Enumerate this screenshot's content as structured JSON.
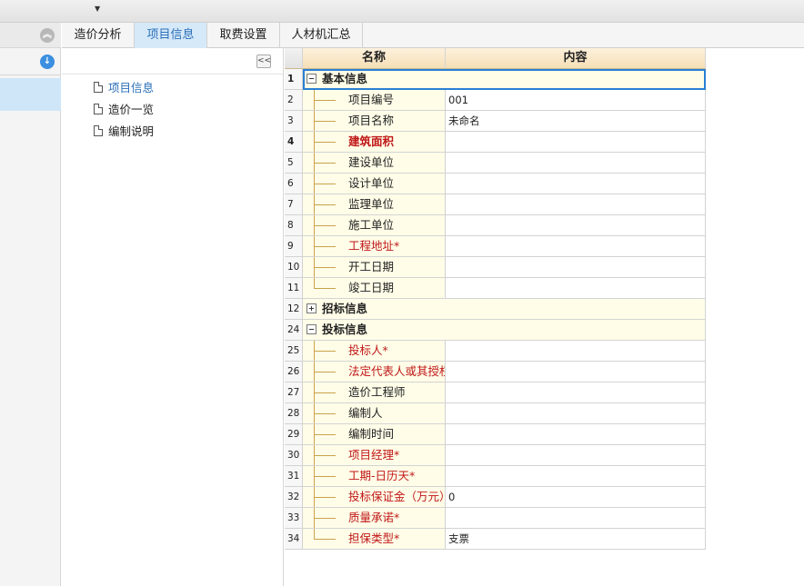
{
  "tabs": [
    {
      "label": "造价分析",
      "active": false
    },
    {
      "label": "项目信息",
      "active": true
    },
    {
      "label": "取费设置",
      "active": false
    },
    {
      "label": "人材机汇总",
      "active": false
    }
  ],
  "tree": [
    {
      "label": "项目信息",
      "selected": true
    },
    {
      "label": "造价一览",
      "selected": false
    },
    {
      "label": "编制说明",
      "selected": false
    }
  ],
  "grid": {
    "headers": {
      "name": "名称",
      "value": "内容"
    },
    "rows": [
      {
        "num": "1",
        "name": "基本信息",
        "value": "",
        "type": "group",
        "expanded": true,
        "selected": true
      },
      {
        "num": "2",
        "name": "项目编号",
        "value": "001",
        "type": "child"
      },
      {
        "num": "3",
        "name": "项目名称",
        "value": "未命名",
        "type": "child"
      },
      {
        "num": "4",
        "name": "建筑面积",
        "value": "",
        "type": "child",
        "red": true,
        "bold": true
      },
      {
        "num": "5",
        "name": "建设单位",
        "value": "",
        "type": "child"
      },
      {
        "num": "6",
        "name": "设计单位",
        "value": "",
        "type": "child"
      },
      {
        "num": "7",
        "name": "监理单位",
        "value": "",
        "type": "child"
      },
      {
        "num": "8",
        "name": "施工单位",
        "value": "",
        "type": "child"
      },
      {
        "num": "9",
        "name": "工程地址*",
        "value": "",
        "type": "child",
        "red": true
      },
      {
        "num": "10",
        "name": "开工日期",
        "value": "",
        "type": "child"
      },
      {
        "num": "11",
        "name": "竣工日期",
        "value": "",
        "type": "child",
        "last": true
      },
      {
        "num": "12",
        "name": "招标信息",
        "value": "",
        "type": "group",
        "expanded": false
      },
      {
        "num": "24",
        "name": "投标信息",
        "value": "",
        "type": "group",
        "expanded": true
      },
      {
        "num": "25",
        "name": "投标人*",
        "value": "",
        "type": "child",
        "red": true
      },
      {
        "num": "26",
        "name": "法定代表人或其授权…",
        "value": "",
        "type": "child",
        "red": true
      },
      {
        "num": "27",
        "name": "造价工程师",
        "value": "",
        "type": "child"
      },
      {
        "num": "28",
        "name": "编制人",
        "value": "",
        "type": "child"
      },
      {
        "num": "29",
        "name": "编制时间",
        "value": "",
        "type": "child"
      },
      {
        "num": "30",
        "name": "项目经理*",
        "value": "",
        "type": "child",
        "red": true
      },
      {
        "num": "31",
        "name": "工期-日历天*",
        "value": "",
        "type": "child",
        "red": true
      },
      {
        "num": "32",
        "name": "投标保证金（万元）*",
        "value": "0",
        "type": "child",
        "red": true
      },
      {
        "num": "33",
        "name": "质量承诺*",
        "value": "",
        "type": "child",
        "red": true
      },
      {
        "num": "34",
        "name": "担保类型*",
        "value": "支票",
        "type": "child",
        "red": true,
        "last": true
      }
    ]
  },
  "icons": {
    "collapse_up": "double-chevron-up-icon",
    "download": "download-arrow-icon",
    "collapse_panel": "double-chevron-left-icon",
    "document": "document-icon"
  },
  "colors": {
    "accent": "#2a7fd4",
    "tab_active_bg": "#d6e9f9",
    "required_text": "#c01818",
    "name_cell_bg": "#fffde8"
  }
}
